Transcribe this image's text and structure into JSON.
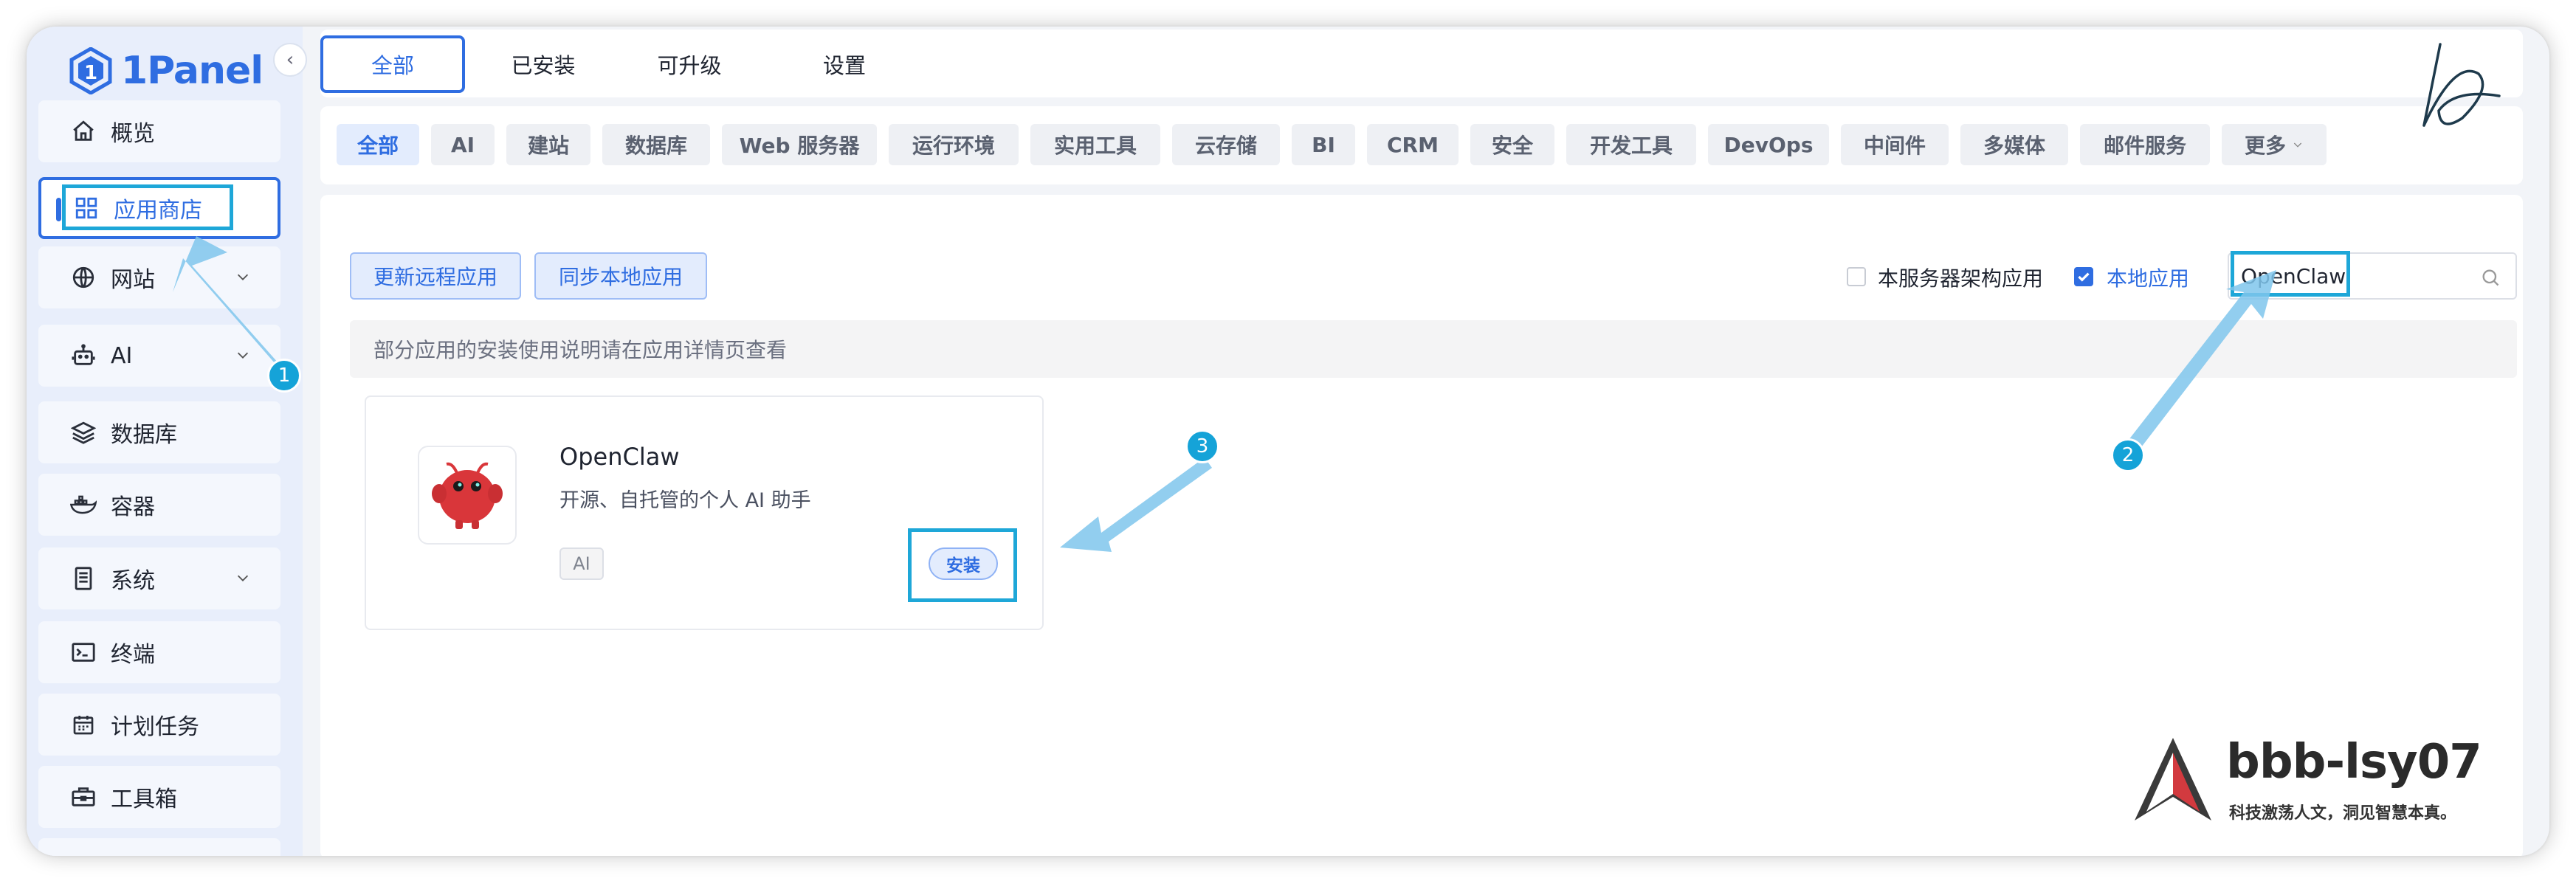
{
  "app": {
    "name": "1Panel"
  },
  "sidebar": {
    "items": [
      {
        "label": "概览",
        "icon": "home-icon"
      },
      {
        "label": "应用商店",
        "icon": "grid-icon",
        "active": true
      },
      {
        "label": "网站",
        "icon": "globe-icon",
        "expandable": true
      },
      {
        "label": "AI",
        "icon": "robot-icon",
        "expandable": true
      },
      {
        "label": "数据库",
        "icon": "layers-icon"
      },
      {
        "label": "容器",
        "icon": "docker-icon"
      },
      {
        "label": "系统",
        "icon": "server-icon",
        "expandable": true
      },
      {
        "label": "终端",
        "icon": "terminal-icon"
      },
      {
        "label": "计划任务",
        "icon": "calendar-icon"
      },
      {
        "label": "工具箱",
        "icon": "toolbox-icon"
      }
    ]
  },
  "tabs": [
    {
      "label": "全部",
      "active": true
    },
    {
      "label": "已安装"
    },
    {
      "label": "可升级"
    },
    {
      "label": "设置"
    }
  ],
  "categories": [
    {
      "label": "全部",
      "active": true
    },
    {
      "label": "AI"
    },
    {
      "label": "建站"
    },
    {
      "label": "数据库"
    },
    {
      "label": "Web 服务器"
    },
    {
      "label": "运行环境"
    },
    {
      "label": "实用工具"
    },
    {
      "label": "云存储"
    },
    {
      "label": "BI"
    },
    {
      "label": "CRM"
    },
    {
      "label": "安全"
    },
    {
      "label": "开发工具"
    },
    {
      "label": "DevOps"
    },
    {
      "label": "中间件"
    },
    {
      "label": "多媒体"
    },
    {
      "label": "邮件服务"
    },
    {
      "label": "更多"
    }
  ],
  "toolbar": {
    "update_remote_label": "更新远程应用",
    "sync_local_label": "同步本地应用",
    "arch_filter_label": "本服务器架构应用",
    "arch_filter_checked": false,
    "local_filter_label": "本地应用",
    "local_filter_checked": true,
    "search_value": "OpenClaw"
  },
  "notice": "部分应用的安装使用说明请在应用详情页查看",
  "apps": [
    {
      "name": "OpenClaw",
      "description": "开源、自托管的个人 AI 助手",
      "tag": "AI",
      "install_label": "安装"
    }
  ],
  "annotations": [
    "1",
    "2",
    "3"
  ],
  "watermark": {
    "text": "bbb-lsy07",
    "slogan": "科技激荡人文，洞见智慧本真。"
  },
  "colors": {
    "brand": "#2f6de1",
    "annotation": "#15a3d8",
    "sidebar_bg": "#e8eefb",
    "page_bg": "#f2f4f8"
  }
}
